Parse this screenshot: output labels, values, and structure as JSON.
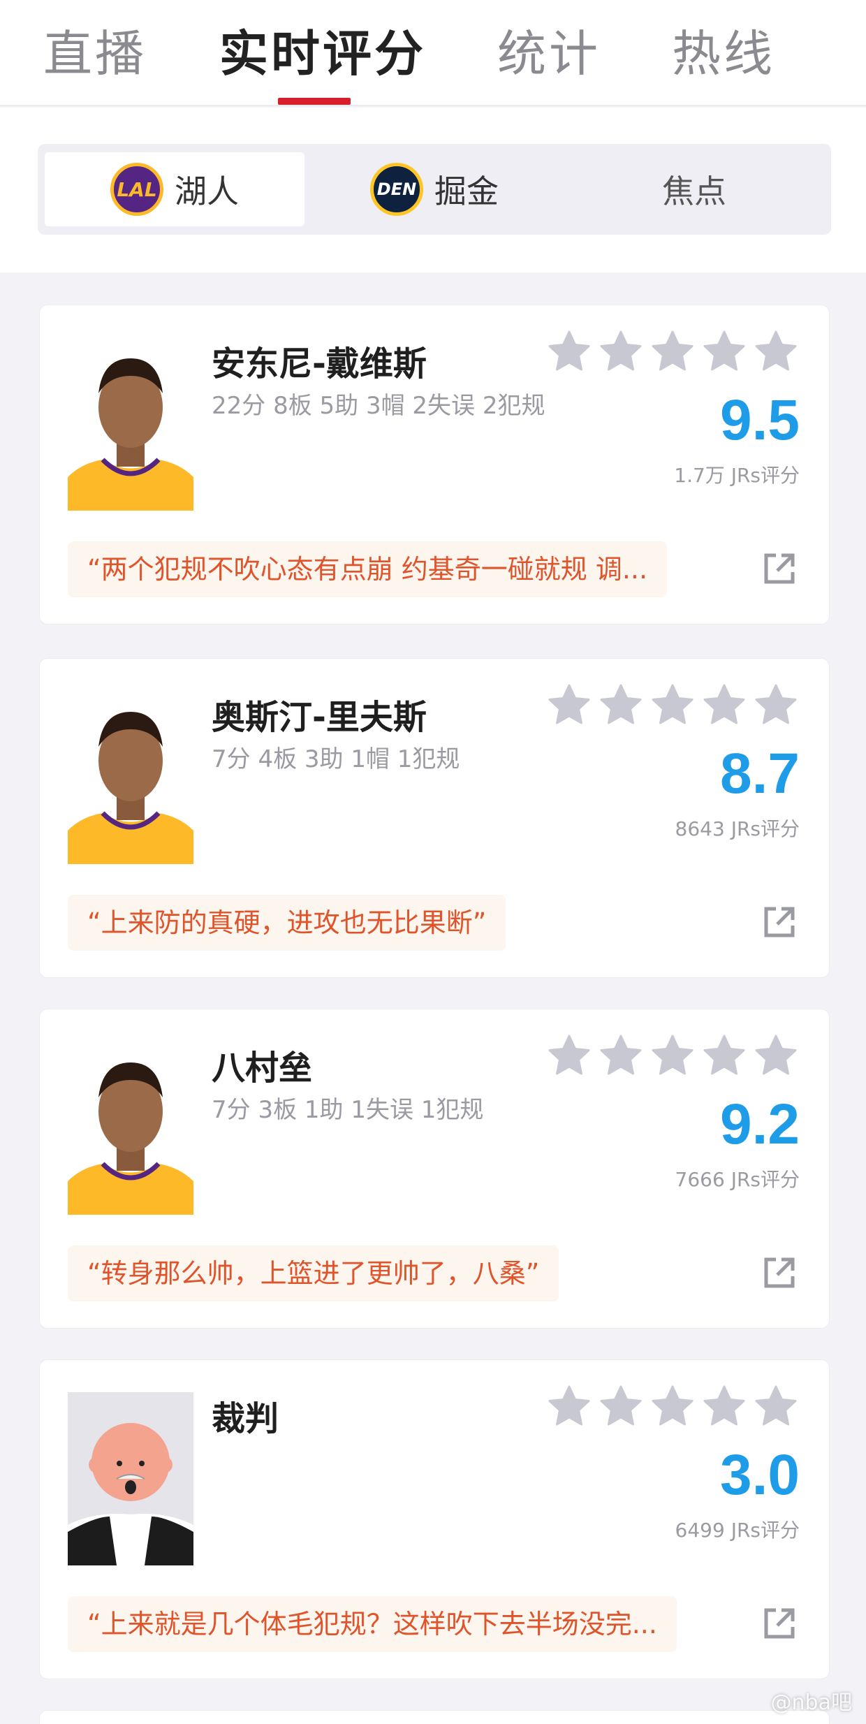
{
  "top_tabs": [
    {
      "label": "直播",
      "active": false
    },
    {
      "label": "实时评分",
      "active": true
    },
    {
      "label": "统计",
      "active": false
    },
    {
      "label": "热线",
      "active": false
    }
  ],
  "team_tabs": [
    {
      "label": "湖人",
      "logo_text": "LAL",
      "active": true
    },
    {
      "label": "掘金",
      "logo_text": "DEN",
      "active": false
    },
    {
      "label": "焦点",
      "active": false
    }
  ],
  "players": [
    {
      "name": "安东尼-戴维斯",
      "stats": "22分 8板 5助 3帽 2失误 2犯规",
      "score": "9.5",
      "votes": "1.7万 JRs评分",
      "quote": "“两个犯规不吹心态有点崩 约基奇一碰就规 调...",
      "avatar": "player-lakers"
    },
    {
      "name": "奥斯汀-里夫斯",
      "stats": "7分 4板 3助 1帽 1犯规",
      "score": "8.7",
      "votes": "8643 JRs评分",
      "quote": "“上来防的真硬，进攻也无比果断”",
      "avatar": "player-lakers"
    },
    {
      "name": "八村垒",
      "stats": "7分 3板 1助 1失误 1犯规",
      "score": "9.2",
      "votes": "7666 JRs评分",
      "quote": "“转身那么帅，上篮进了更帅了，八桑”",
      "avatar": "player-lakers"
    },
    {
      "name": "裁判",
      "stats": "",
      "score": "3.0",
      "votes": "6499 JRs评分",
      "quote": "“上来就是几个体毛犯规？这样吹下去半场没完...",
      "avatar": "referee-cartoon"
    }
  ],
  "colors": {
    "accent_red": "#d81e2a",
    "score_blue": "#1f9ce8",
    "quote_orange": "#e0542c",
    "star_gray": "#c8c8d2"
  },
  "watermark": "@nba吧"
}
